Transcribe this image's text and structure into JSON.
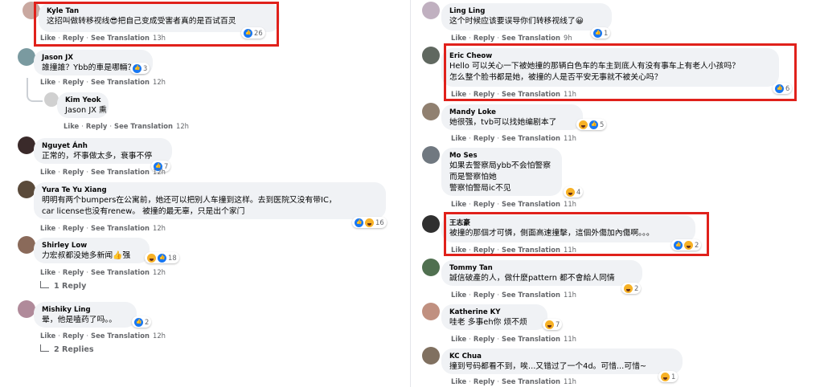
{
  "actions": {
    "like": "Like",
    "reply": "Reply",
    "see_translation": "See Translation"
  },
  "left": [
    {
      "id": "kyle",
      "name": "Kyle Tan",
      "text": [
        "这招叫做转移视线😎把自己变成受害者真的是百试百灵"
      ],
      "time": "13h",
      "count": "26",
      "reactions": [
        "like"
      ],
      "avatar": "#c9a8a0"
    },
    {
      "id": "jason",
      "name": "Jason JX",
      "text": [
        "誰撞誰？Ybb的車是哪輛？"
      ],
      "time": "12h",
      "count": "3",
      "reactions": [
        "like"
      ],
      "avatar": "#7a9aa0"
    },
    {
      "id": "kim",
      "name": "Kim Yeok",
      "text": [
        "Jason JX 熏"
      ],
      "time": "12h",
      "count": "",
      "reactions": [],
      "avatar": "#d0d0d0"
    },
    {
      "id": "nguyet",
      "name": "Nguyet Ánh",
      "text": [
        "正常的，坏事做太多，衰事不停"
      ],
      "time": "12h",
      "count": "7",
      "reactions": [
        "like"
      ],
      "avatar": "#3a2a2a"
    },
    {
      "id": "yura",
      "name": "Yura Te Yu Xiang",
      "text": [
        "明明有两个bumpers在公寓前，她还可以把别人车撞到这样。去到医院又没有带IC，",
        "car license也没有renew。 被撞的最无辜，只是出个家门"
      ],
      "time": "12h",
      "count": "16",
      "reactions": [
        "like",
        "haha"
      ],
      "avatar": "#5a4a3a"
    },
    {
      "id": "shirley",
      "name": "Shirley Low",
      "text": [
        "力宏叔都没她多新闻👍强"
      ],
      "time": "12h",
      "count": "18",
      "reactions": [
        "haha",
        "like"
      ],
      "avatar": "#8a6a5a"
    },
    {
      "id": "mishiky",
      "name": "Mishiky Ling",
      "text": [
        "晕，他是嗑药了吗。。"
      ],
      "time": "12h",
      "count": "2",
      "reactions": [
        "like"
      ],
      "avatar": "#b08a9a"
    }
  ],
  "left_replies": [
    {
      "id": "shirley",
      "label": "1 Reply"
    },
    {
      "id": "mishiky",
      "label": "2 Replies"
    }
  ],
  "right": [
    {
      "id": "ling",
      "name": "Ling Ling",
      "text": [
        "这个时候应该要误导你们转移视线了😀"
      ],
      "time": "9h",
      "count": "1",
      "reactions": [
        "like"
      ],
      "avatar": "#c0b0c0"
    },
    {
      "id": "eric",
      "name": "Eric Cheow",
      "text": [
        "Hello 可以关心一下被她撞的那辆白色车的车主到底人有没有事车上有老人小孩吗？",
        "怎么整个脸书都是她，被撞的人是否平安无事就不被关心吗？"
      ],
      "time": "11h",
      "count": "6",
      "reactions": [
        "like"
      ],
      "avatar": "#606860"
    },
    {
      "id": "mandy",
      "name": "Mandy Loke",
      "text": [
        "她很强，tvb可以找她编剧本了"
      ],
      "time": "11h",
      "count": "5",
      "reactions": [
        "haha",
        "like"
      ],
      "avatar": "#908070"
    },
    {
      "id": "mo",
      "name": "Mo Ses",
      "text": [
        "如果去警察局ybb不会怕警察",
        "而是警察怕她",
        "警察怕警局ic不见"
      ],
      "time": "11h",
      "count": "4",
      "reactions": [
        "haha"
      ],
      "avatar": "#707880"
    },
    {
      "id": "wang",
      "name": "王志豪",
      "text": [
        "被撞的那個才可憐，側面高速撞擊，這個外傷加內傷啊。。。"
      ],
      "time": "11h",
      "count": "2",
      "reactions": [
        "like",
        "haha"
      ],
      "avatar": "#303030"
    },
    {
      "id": "tommy",
      "name": "Tommy Tan",
      "text": [
        "誠信破產的人，做什麼pattern 都不會給人同情"
      ],
      "time": "11h",
      "count": "2",
      "reactions": [
        "haha"
      ],
      "avatar": "#507050"
    },
    {
      "id": "katherine",
      "name": "Katherine KY",
      "text": [
        "哇老 多事eh你 烦不烦"
      ],
      "time": "11h",
      "count": "7",
      "reactions": [
        "haha"
      ],
      "avatar": "#c09080"
    },
    {
      "id": "kc",
      "name": "KC Chua",
      "text": [
        "撞到号码都看不到，唉...又错过了一个4d。可惜...可惜~"
      ],
      "time": "11h",
      "count": "1",
      "reactions": [
        "haha"
      ],
      "avatar": "#807060"
    }
  ]
}
